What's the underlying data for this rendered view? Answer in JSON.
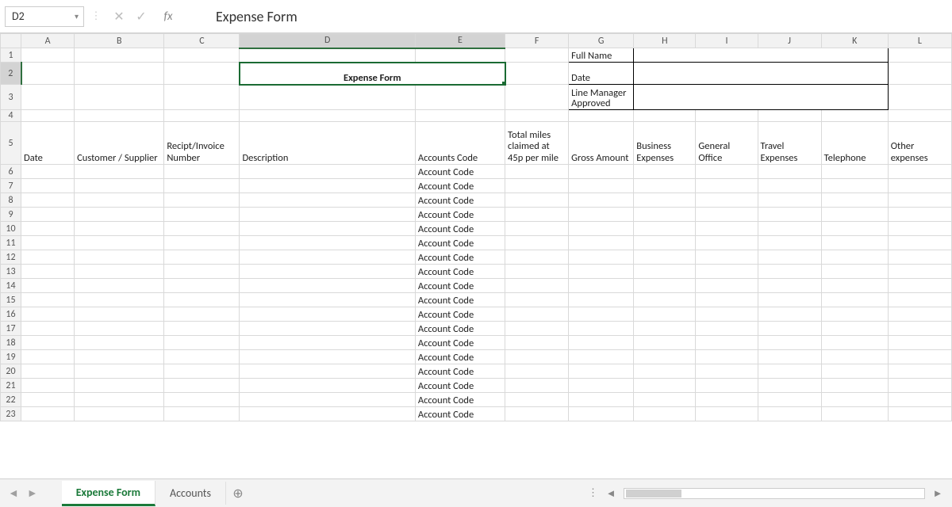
{
  "formula_bar": {
    "cell_ref": "D2",
    "fx_label": "fx",
    "content": "Expense Form"
  },
  "columns": [
    "A",
    "B",
    "C",
    "D",
    "E",
    "F",
    "G",
    "H",
    "I",
    "J",
    "K",
    "L"
  ],
  "row_count": 23,
  "title": "Expense Form",
  "info_labels": {
    "full_name": "Full Name",
    "date": "Date",
    "line_manager": "Line Manager Approved"
  },
  "table_headers": {
    "date": "Date",
    "customer": "Customer / Supplier",
    "receipt": "Recipt/Invoice Number",
    "description": "Description",
    "accounts_code": "Accounts Code",
    "miles": "Total miles claimed at 45p per mile",
    "gross": "Gross Amount",
    "business": "Business Expenses",
    "general": "General Office",
    "travel": "Travel Expenses",
    "telephone": "Telephone",
    "other": "Other expenses"
  },
  "account_code_placeholder": "Account Code",
  "tabs": {
    "active": "Expense Form",
    "others": [
      "Accounts"
    ]
  },
  "selected_cell_row": 2,
  "selected_cols": [
    "D",
    "E"
  ],
  "col_widths": {
    "A": 67,
    "B": 113,
    "C": 95,
    "D": 221,
    "E": 113,
    "F": 80,
    "G": 82,
    "H": 78,
    "I": 78,
    "J": 80,
    "K": 84,
    "L": 80
  }
}
